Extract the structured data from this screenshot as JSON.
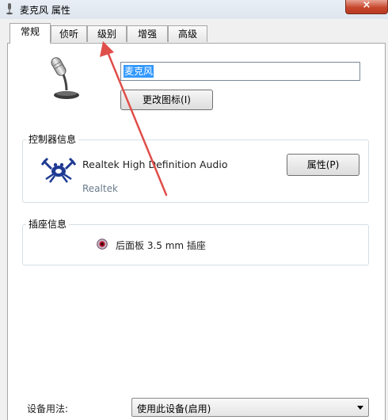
{
  "window": {
    "title": "麦克风 属性",
    "close_glyph": "×"
  },
  "tabs": [
    {
      "label": "常规",
      "active": true
    },
    {
      "label": "侦听",
      "active": false
    },
    {
      "label": "级别",
      "active": false
    },
    {
      "label": "增强",
      "active": false
    },
    {
      "label": "高级",
      "active": false
    }
  ],
  "device": {
    "name_value": "麦克风",
    "change_icon_button": "更改图标(I)"
  },
  "controller": {
    "group_label": "控制器信息",
    "name": "Realtek High Definition Audio",
    "vendor": "Realtek",
    "properties_button": "属性(P)"
  },
  "jack": {
    "group_label": "插座信息",
    "description": "后面板 3.5 mm 插座"
  },
  "usage": {
    "label": "设备用法:",
    "selected": "使用此设备(启用)"
  },
  "colors": {
    "annotation_arrow": "#e04e4a",
    "selection": "#3399ff",
    "close_button": "#c7482e"
  },
  "icons": {
    "title": "microphone-icon",
    "device": "microphone-icon",
    "controller": "realtek-crab-icon",
    "jack": "audio-jack-icon"
  }
}
